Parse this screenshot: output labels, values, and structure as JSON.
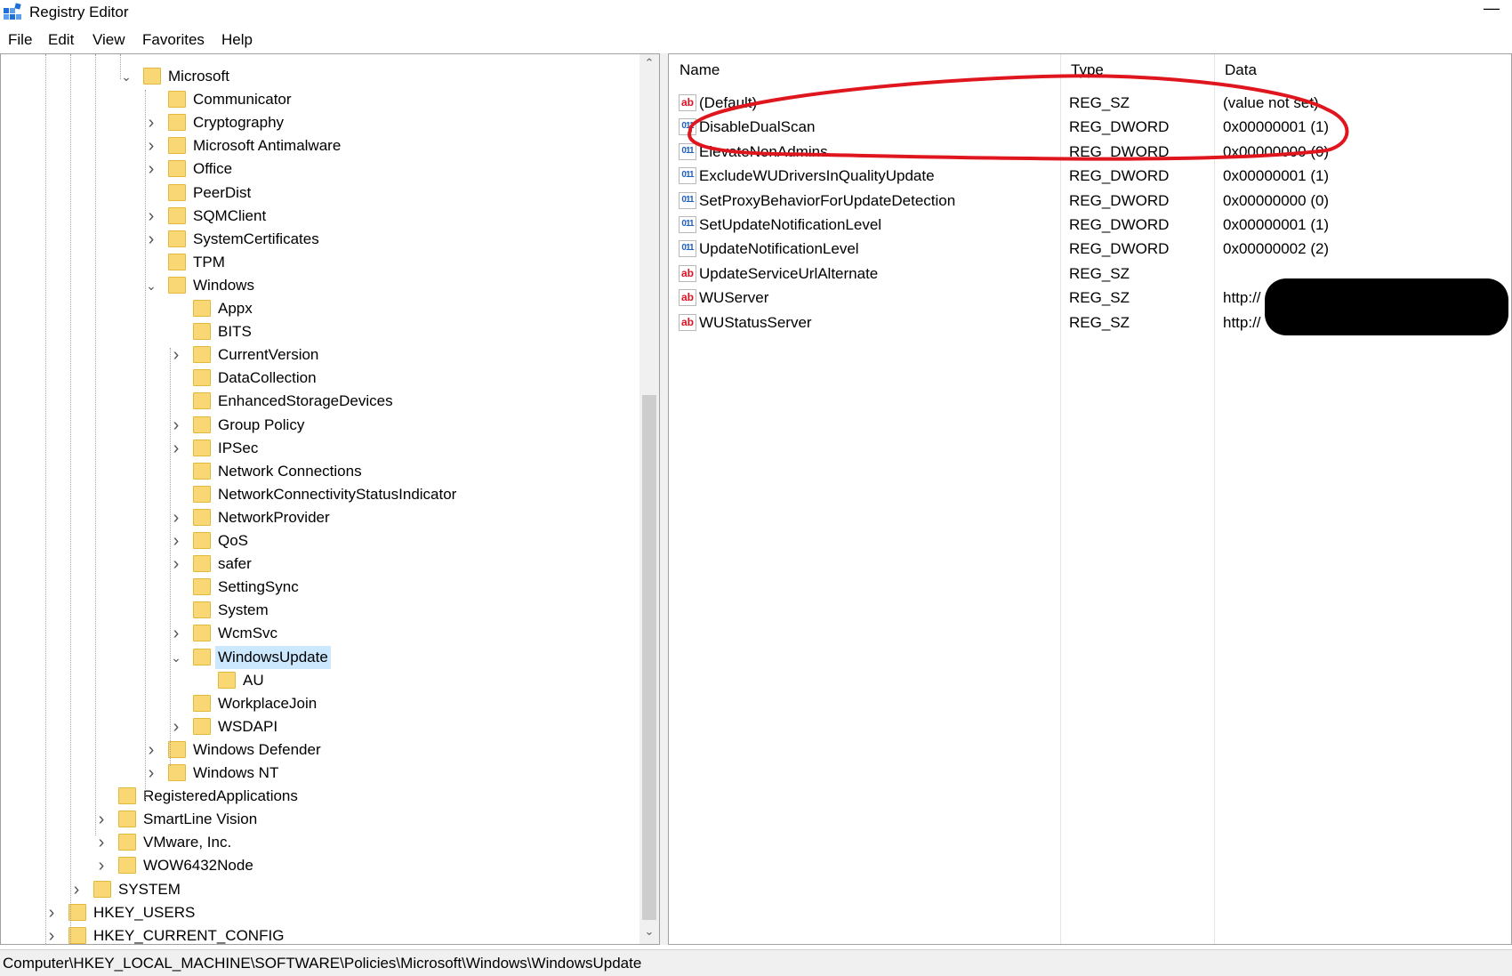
{
  "window": {
    "title": "Registry Editor",
    "minimize_glyph": "—"
  },
  "menu": {
    "items": [
      "File",
      "Edit",
      "View",
      "Favorites",
      "Help"
    ]
  },
  "tree": {
    "nodes": [
      {
        "label": "Microsoft",
        "level": 4,
        "expander": "expanded"
      },
      {
        "label": "Communicator",
        "level": 5,
        "expander": "none"
      },
      {
        "label": "Cryptography",
        "level": 5,
        "expander": "collapsed"
      },
      {
        "label": "Microsoft Antimalware",
        "level": 5,
        "expander": "collapsed"
      },
      {
        "label": "Office",
        "level": 5,
        "expander": "collapsed"
      },
      {
        "label": "PeerDist",
        "level": 5,
        "expander": "none"
      },
      {
        "label": "SQMClient",
        "level": 5,
        "expander": "collapsed"
      },
      {
        "label": "SystemCertificates",
        "level": 5,
        "expander": "collapsed"
      },
      {
        "label": "TPM",
        "level": 5,
        "expander": "none"
      },
      {
        "label": "Windows",
        "level": 5,
        "expander": "expanded"
      },
      {
        "label": "Appx",
        "level": 6,
        "expander": "none"
      },
      {
        "label": "BITS",
        "level": 6,
        "expander": "none"
      },
      {
        "label": "CurrentVersion",
        "level": 6,
        "expander": "collapsed"
      },
      {
        "label": "DataCollection",
        "level": 6,
        "expander": "none"
      },
      {
        "label": "EnhancedStorageDevices",
        "level": 6,
        "expander": "none"
      },
      {
        "label": "Group Policy",
        "level": 6,
        "expander": "collapsed"
      },
      {
        "label": "IPSec",
        "level": 6,
        "expander": "collapsed"
      },
      {
        "label": "Network Connections",
        "level": 6,
        "expander": "none"
      },
      {
        "label": "NetworkConnectivityStatusIndicator",
        "level": 6,
        "expander": "none"
      },
      {
        "label": "NetworkProvider",
        "level": 6,
        "expander": "collapsed"
      },
      {
        "label": "QoS",
        "level": 6,
        "expander": "collapsed"
      },
      {
        "label": "safer",
        "level": 6,
        "expander": "collapsed"
      },
      {
        "label": "SettingSync",
        "level": 6,
        "expander": "none"
      },
      {
        "label": "System",
        "level": 6,
        "expander": "none"
      },
      {
        "label": "WcmSvc",
        "level": 6,
        "expander": "collapsed"
      },
      {
        "label": "WindowsUpdate",
        "level": 6,
        "expander": "expanded",
        "selected": true
      },
      {
        "label": "AU",
        "level": 7,
        "expander": "none"
      },
      {
        "label": "WorkplaceJoin",
        "level": 6,
        "expander": "none"
      },
      {
        "label": "WSDAPI",
        "level": 6,
        "expander": "collapsed"
      },
      {
        "label": "Windows Defender",
        "level": 5,
        "expander": "collapsed"
      },
      {
        "label": "Windows NT",
        "level": 5,
        "expander": "collapsed"
      },
      {
        "label": "RegisteredApplications",
        "level": 3,
        "expander": "none"
      },
      {
        "label": "SmartLine Vision",
        "level": 3,
        "expander": "collapsed"
      },
      {
        "label": "VMware, Inc.",
        "level": 3,
        "expander": "collapsed"
      },
      {
        "label": "WOW6432Node",
        "level": 3,
        "expander": "collapsed"
      },
      {
        "label": "SYSTEM",
        "level": 2,
        "expander": "collapsed"
      },
      {
        "label": "HKEY_USERS",
        "level": 1,
        "expander": "collapsed"
      },
      {
        "label": "HKEY_CURRENT_CONFIG",
        "level": 1,
        "expander": "collapsed"
      }
    ]
  },
  "values_table": {
    "columns": [
      "Name",
      "Type",
      "Data"
    ],
    "rows": [
      {
        "name": "(Default)",
        "type": "REG_SZ",
        "data": "(value not set)",
        "icon": "string-value-icon"
      },
      {
        "name": "DisableDualScan",
        "type": "REG_DWORD",
        "data": "0x00000001 (1)",
        "icon": "dword-value-icon"
      },
      {
        "name": "ElevateNonAdmins",
        "type": "REG_DWORD",
        "data": "0x00000000 (0)",
        "icon": "dword-value-icon"
      },
      {
        "name": "ExcludeWUDriversInQualityUpdate",
        "type": "REG_DWORD",
        "data": "0x00000001 (1)",
        "icon": "dword-value-icon"
      },
      {
        "name": "SetProxyBehaviorForUpdateDetection",
        "type": "REG_DWORD",
        "data": "0x00000000 (0)",
        "icon": "dword-value-icon"
      },
      {
        "name": "SetUpdateNotificationLevel",
        "type": "REG_DWORD",
        "data": "0x00000001 (1)",
        "icon": "dword-value-icon"
      },
      {
        "name": "UpdateNotificationLevel",
        "type": "REG_DWORD",
        "data": "0x00000002 (2)",
        "icon": "dword-value-icon"
      },
      {
        "name": "UpdateServiceUrlAlternate",
        "type": "REG_SZ",
        "data": "",
        "icon": "string-value-icon"
      },
      {
        "name": "WUServer",
        "type": "REG_SZ",
        "data": "http://",
        "icon": "string-value-icon"
      },
      {
        "name": "WUStatusServer",
        "type": "REG_SZ",
        "data": "http://",
        "icon": "string-value-icon"
      }
    ]
  },
  "status": {
    "path": "Computer\\HKEY_LOCAL_MACHINE\\SOFTWARE\\Policies\\Microsoft\\Windows\\WindowsUpdate"
  },
  "colors": {
    "selection": "#cce8ff",
    "folder": "#f8d774",
    "annotation": "#e0161e"
  }
}
